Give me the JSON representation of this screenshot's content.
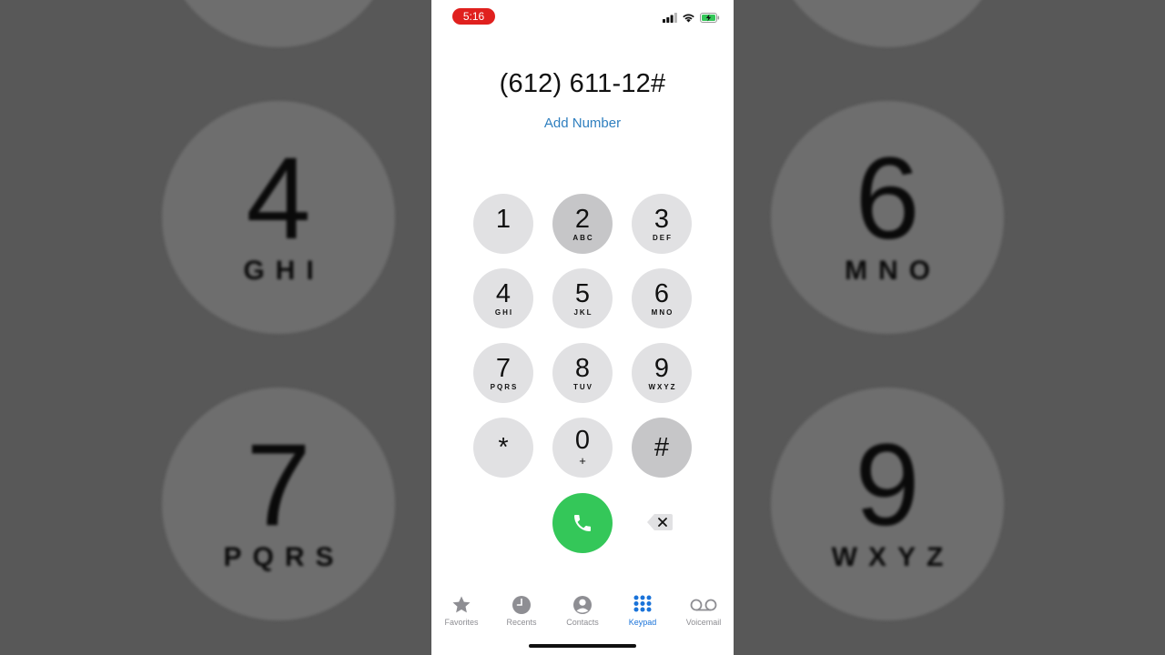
{
  "status_bar": {
    "time": "5:16",
    "colors": {
      "time_pill": "#e0201e",
      "battery": "#34c759"
    },
    "icons": [
      "cellular-signal-icon",
      "wifi-icon",
      "battery-charging-icon"
    ]
  },
  "dialer": {
    "number": "(612) 611-12#",
    "add_number": "Add Number"
  },
  "keys": [
    {
      "digit": "1",
      "letters": ""
    },
    {
      "digit": "2",
      "letters": "ABC",
      "pressed": true
    },
    {
      "digit": "3",
      "letters": "DEF"
    },
    {
      "digit": "4",
      "letters": "GHI"
    },
    {
      "digit": "5",
      "letters": "JKL"
    },
    {
      "digit": "6",
      "letters": "MNO"
    },
    {
      "digit": "7",
      "letters": "PQRS"
    },
    {
      "digit": "8",
      "letters": "TUV"
    },
    {
      "digit": "9",
      "letters": "WXYZ"
    },
    {
      "digit": "*",
      "letters": ""
    },
    {
      "digit": "0",
      "letters": "+"
    },
    {
      "digit": "#",
      "letters": "",
      "pressed": true
    }
  ],
  "call_button": {
    "icon": "phone-icon",
    "color": "#34c759"
  },
  "delete_button": {
    "icon": "delete-backspace-icon"
  },
  "tabs": [
    {
      "label": "Favorites",
      "icon": "star-icon"
    },
    {
      "label": "Recents",
      "icon": "clock-icon"
    },
    {
      "label": "Contacts",
      "icon": "person-circle-icon"
    },
    {
      "label": "Keypad",
      "icon": "keypad-grid-icon",
      "active": true
    },
    {
      "label": "Voicemail",
      "icon": "voicemail-icon"
    }
  ],
  "background_zoom": {
    "keys": [
      {
        "digit": "4",
        "letters": "GHI"
      },
      {
        "digit": "6",
        "letters": "MNO"
      },
      {
        "digit": "7",
        "letters": "PQRS"
      },
      {
        "digit": "9",
        "letters": "WXYZ"
      }
    ]
  },
  "colors": {
    "accent": "#1a73d9",
    "link": "#2f7fbf",
    "key_bg": "#e1e1e3",
    "key_pressed_bg": "#c6c6c8"
  }
}
